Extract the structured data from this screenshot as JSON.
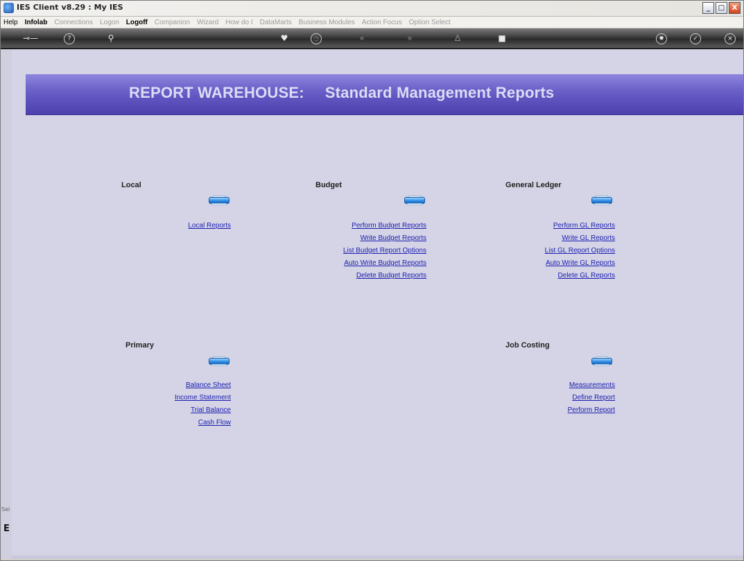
{
  "window": {
    "title": "IES Client v8.29 : My IES",
    "buttons": {
      "minimize": "_",
      "maximize": "□",
      "close": "X"
    }
  },
  "menu": {
    "items": [
      {
        "label": "Help",
        "state": "active"
      },
      {
        "label": "Infolab",
        "state": "active"
      },
      {
        "label": "Connections",
        "state": "disabled"
      },
      {
        "label": "Logon",
        "state": "disabled"
      },
      {
        "label": "Logoff",
        "state": "active"
      },
      {
        "label": "Companion",
        "state": "disabled"
      },
      {
        "label": "Wizard",
        "state": "disabled"
      },
      {
        "label": "How do I",
        "state": "disabled"
      },
      {
        "label": "DataMarts",
        "state": "disabled"
      },
      {
        "label": "Business Modules",
        "state": "disabled"
      },
      {
        "label": "Action Focus",
        "state": "disabled"
      },
      {
        "label": "Option Select",
        "state": "disabled"
      }
    ]
  },
  "toolbar": {
    "icons": [
      "key-icon",
      "help-icon",
      "search-icon",
      "heart-icon",
      "clock-icon",
      "back-icon",
      "forward-icon",
      "pin-icon",
      "stop-icon",
      "settings-icon",
      "ok-icon",
      "close-icon"
    ]
  },
  "banner": {
    "left": "REPORT WAREHOUSE:",
    "right": "Standard Management Reports"
  },
  "sections": {
    "local": {
      "title": "Local",
      "links": [
        "Local Reports"
      ]
    },
    "budget": {
      "title": "Budget",
      "links": [
        "Perform Budget Reports",
        "Write Budget Reports",
        "List Budget Report Options",
        "Auto Write Budget Reports",
        "Delete Budget Reports"
      ]
    },
    "general_ledger": {
      "title": "General Ledger",
      "links": [
        "Perform GL Reports",
        "Write GL Reports",
        "List GL Report Options",
        "Auto Write GL Reports",
        "Delete GL Reports"
      ]
    },
    "primary": {
      "title": "Primary",
      "links": [
        "Balance Sheet",
        "Income Statement",
        "Trial Balance",
        "Cash Flow"
      ]
    },
    "job_costing": {
      "title": "Job Costing",
      "links": [
        "Measurements",
        "Define Report",
        "Perform Report"
      ]
    }
  },
  "left_strip": {
    "text": "Sei",
    "glyph": "E"
  },
  "colors": {
    "banner": "#5a4fbc",
    "banner_text": "#dcdcf5",
    "client_bg": "#d4d4e6",
    "link": "#1b1bb0"
  }
}
